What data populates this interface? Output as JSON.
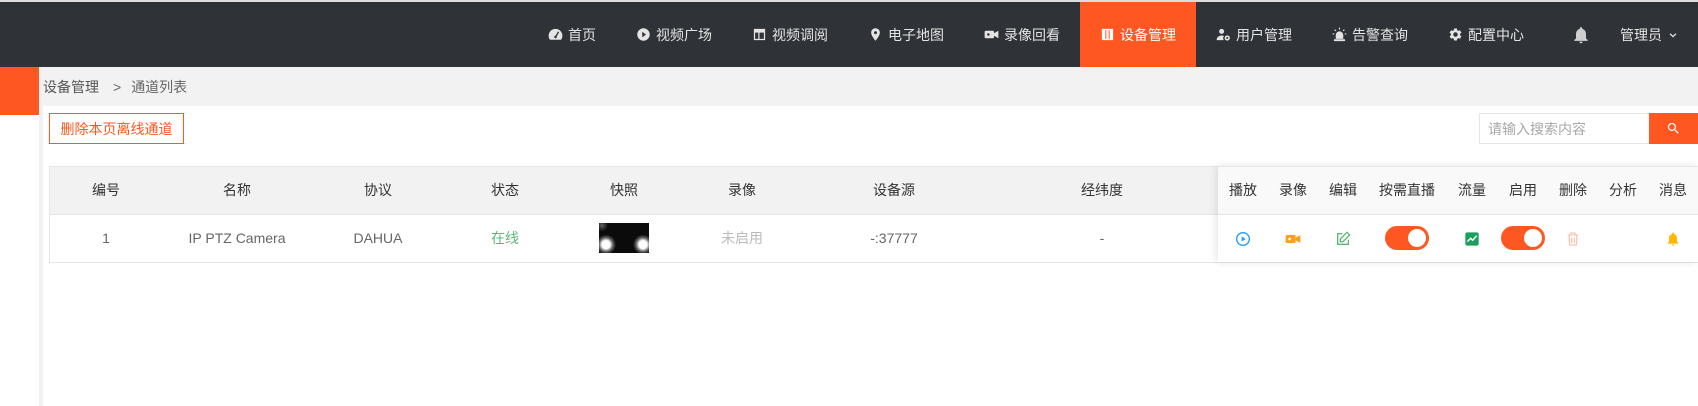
{
  "nav": {
    "items": [
      {
        "label": "首页",
        "icon": "dashboard-icon"
      },
      {
        "label": "视频广场",
        "icon": "play-circle-icon"
      },
      {
        "label": "视频调阅",
        "icon": "layout-icon"
      },
      {
        "label": "电子地图",
        "icon": "map-pin-icon"
      },
      {
        "label": "录像回看",
        "icon": "video-camera-icon"
      },
      {
        "label": "设备管理",
        "icon": "device-columns-icon",
        "active": true
      },
      {
        "label": "用户管理",
        "icon": "user-settings-icon"
      },
      {
        "label": "告警查询",
        "icon": "alarm-icon"
      },
      {
        "label": "配置中心",
        "icon": "gear-icon"
      }
    ],
    "notifications_icon": "bell-icon",
    "user_label": "管理员",
    "user_menu_icon": "chevron-down-icon"
  },
  "breadcrumb": {
    "items": [
      "设备管理",
      "通道列表"
    ],
    "separator": ">"
  },
  "toolbar": {
    "delete_offline_label": "删除本页离线通道",
    "search_placeholder": "请输入搜索内容",
    "search_icon": "search-icon"
  },
  "table": {
    "columns": [
      "编号",
      "名称",
      "协议",
      "状态",
      "快照",
      "录像",
      "设备源",
      "经纬度",
      "播放",
      "录像",
      "编辑",
      "按需直播",
      "流量",
      "启用",
      "删除",
      "分析",
      "消息"
    ],
    "rows": [
      {
        "id": "1",
        "name": "IP PTZ Camera",
        "protocol": "DAHUA",
        "status": "在线",
        "recording": "未启用",
        "source": "-:37777",
        "location": "-",
        "on_demand_live": true,
        "enabled": true,
        "action_icons": [
          "play-circle-icon",
          "video-camera-icon",
          "edit-icon",
          "flow-chart-icon",
          "trash-icon",
          "bell-icon"
        ]
      }
    ]
  },
  "colors": {
    "accent": "#ff5722",
    "nav_bg": "#2f3237",
    "status_online": "#5fb878",
    "play": "#1e9fff",
    "record": "#ff9f1a",
    "edit": "#5fb878",
    "flow": "#1aa05a",
    "message": "#ffb800",
    "delete_disabled": "#f8c6b5"
  }
}
